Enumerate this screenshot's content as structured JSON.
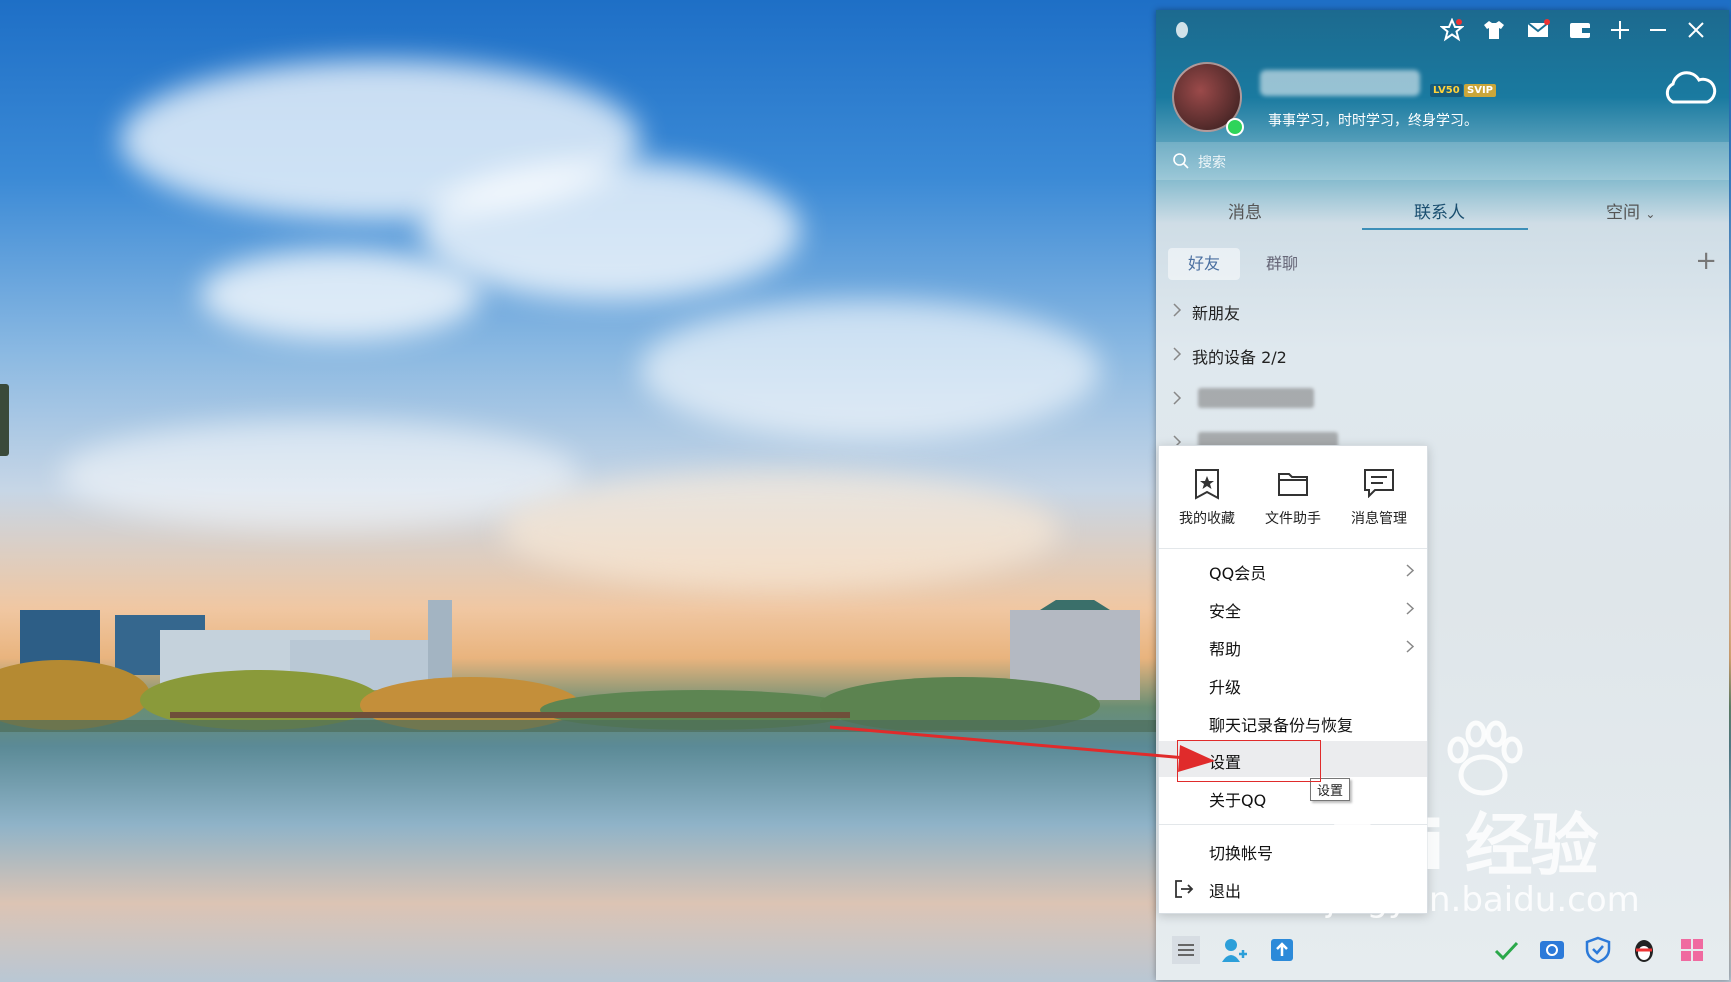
{
  "window": {
    "app_name": "QQ",
    "signature": "事事学习，时时学习，终身学习。",
    "badges": [
      "LV50",
      "SVIP"
    ]
  },
  "topbar": {
    "icons": [
      "bell-icon",
      "star-icon",
      "shirt-icon",
      "mail-icon",
      "wallet-icon",
      "add-icon",
      "minimize-icon",
      "close-icon"
    ]
  },
  "search": {
    "placeholder": "搜索"
  },
  "tabs": {
    "messages": "消息",
    "contacts": "联系人",
    "space": "空间"
  },
  "subtabs": {
    "friends": "好友",
    "groups": "群聊"
  },
  "groups": [
    {
      "label": "新朋友"
    },
    {
      "label": "我的设备 2/2"
    }
  ],
  "menu": {
    "quick": [
      {
        "label": "我的收藏",
        "icon": "star-bookmark-icon"
      },
      {
        "label": "文件助手",
        "icon": "folder-icon"
      },
      {
        "label": "消息管理",
        "icon": "chat-icon"
      }
    ],
    "items": [
      {
        "label": "QQ会员",
        "has_submenu": true
      },
      {
        "label": "安全",
        "has_submenu": true
      },
      {
        "label": "帮助",
        "has_submenu": true
      },
      {
        "label": "升级",
        "has_submenu": false
      },
      {
        "label": "聊天记录备份与恢复",
        "has_submenu": false
      },
      {
        "label": "设置",
        "has_submenu": false,
        "hovered": true
      },
      {
        "label": "关于QQ",
        "has_submenu": false
      }
    ],
    "footer": [
      {
        "label": "切换帐号"
      },
      {
        "label": "退出",
        "icon": "logout-icon"
      }
    ]
  },
  "tooltip": {
    "text": "设置"
  },
  "watermark": {
    "main": "Bai 经验",
    "url": "jingyan.baidu.com"
  },
  "colors": {
    "accent": "#3d8fb8",
    "annotation": "#e02b2b",
    "online": "#2fd45a"
  }
}
